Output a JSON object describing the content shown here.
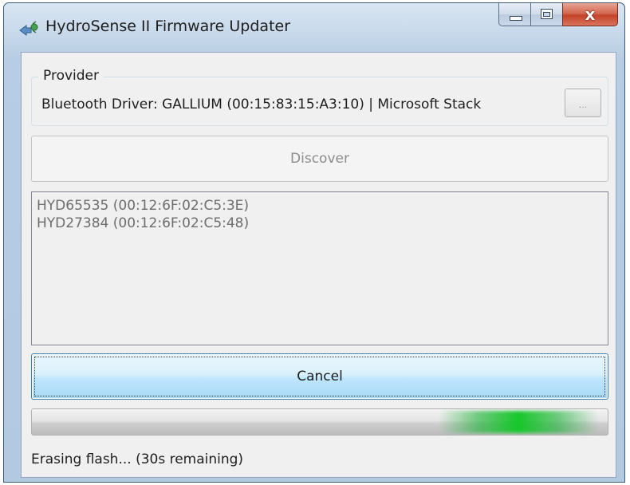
{
  "window": {
    "title": "HydroSense II Firmware Updater",
    "close_glyph": "x"
  },
  "provider": {
    "label": "Provider",
    "value": "Bluetooth Driver: GALLIUM (00:15:83:15:A3:10) | Microsoft Stack",
    "browse_label": "..."
  },
  "discover": {
    "label": "Discover",
    "enabled": false
  },
  "devices": [
    "HYD65535  (00:12:6F:02:C5:3E)",
    "HYD27384  (00:12:6F:02:C5:48)"
  ],
  "cancel": {
    "label": "Cancel"
  },
  "progress": {
    "mode": "indeterminate",
    "color": "#15c72a"
  },
  "status": {
    "text": "Erasing flash... (30s remaining)"
  },
  "icons": {
    "app": "bluetooth-device-icon",
    "minimize": "minimize-icon",
    "maximize": "maximize-icon",
    "close": "close-icon"
  }
}
